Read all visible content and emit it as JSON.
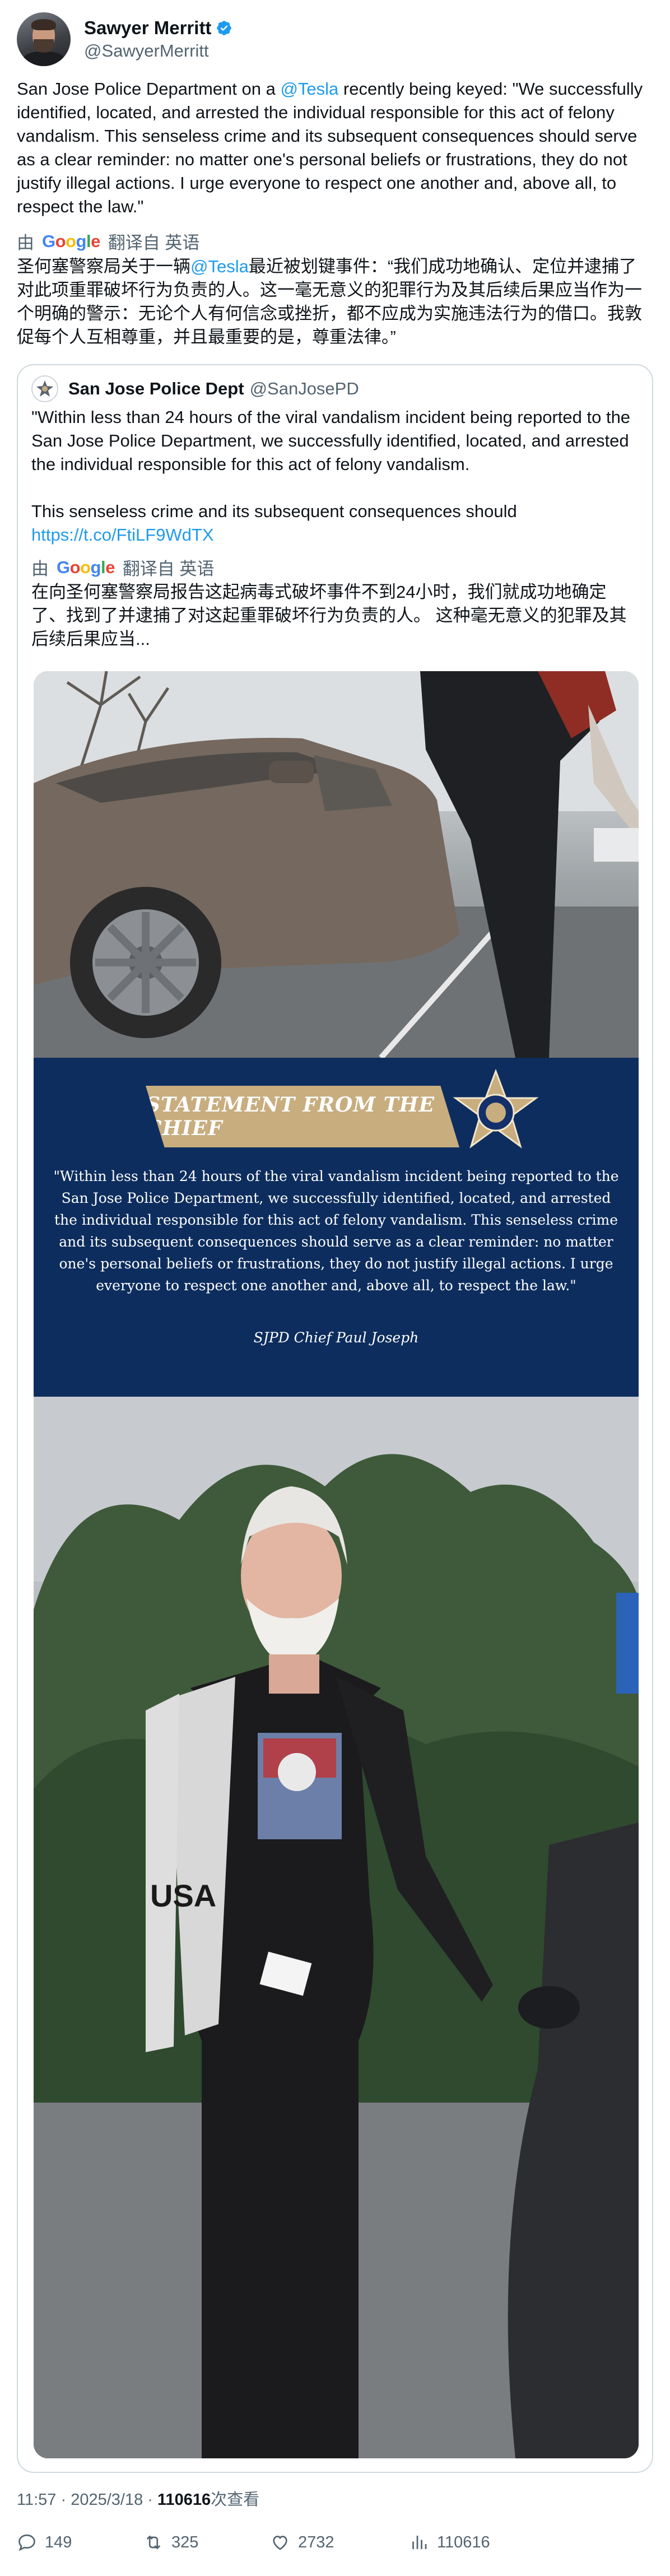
{
  "author": {
    "name": "Sawyer Merritt",
    "handle": "@SawyerMerritt"
  },
  "tweet": {
    "text_before_mention": "San Jose Police Department on a ",
    "mention": "@Tesla",
    "text_after_mention": " recently being keyed: \"We successfully identified, located, and arrested the individual responsible for this act of felony vandalism. This senseless crime and its subsequent consequences should serve as a clear reminder: no matter one's personal beliefs or frustrations, they do not justify illegal actions. I urge everyone to respect one another and, above all, to respect the law.\""
  },
  "translation": {
    "by_label": "由",
    "google_letters": [
      "G",
      "o",
      "o",
      "g",
      "l",
      "e"
    ],
    "from_label": "翻译自 英语",
    "text_before_mention": "圣何塞警察局关于一辆",
    "mention": "@Tesla",
    "text_after_mention": "最近被划键事件：“我们成功地确认、定位并逮捕了对此项重罪破坏行为负责的人。这一毫无意义的犯罪行为及其后续后果应当作为一个明确的警示：无论个人有何信念或挫折，都不应成为实施违法行为的借口。我敦促每个人互相尊重，并且最重要的是，尊重法律。”"
  },
  "quoted": {
    "name": "San Jose Police Dept",
    "handle": "@SanJosePD",
    "text": "\"Within less than 24 hours of the viral vandalism incident being reported to the San Jose Police Department, we successfully identified, located, and arrested the individual responsible for this act of felony vandalism.\n\nThis senseless crime and its subsequent consequences should ",
    "link": "https://t.co/FtiLF9WdTX",
    "translation_by": "由",
    "translation_from": "翻译自 英语",
    "translation_text": "在向圣何塞警察局报告这起病毒式破坏事件不到24小时，我们就成功地确定了、找到了并逮捕了对这起重罪破坏行为负责的人。 这种毫无意义的犯罪及其后续后果应当..."
  },
  "media": {
    "banner_title": "STATEMENT FROM THE CHIEF",
    "quote": "\"Within less than 24 hours of the viral vandalism incident being reported to the San Jose Police Department, we successfully identified, located, and arrested the individual responsible for this act of felony vandalism. This senseless crime and its subsequent consequences should serve as a clear reminder: no matter one's personal beliefs or frustrations, they do not justify illegal actions. I urge everyone to respect one another and, above all, to respect the law.\"",
    "signature": "SJPD  Chief Paul Joseph",
    "shirt_text": "USA"
  },
  "meta": {
    "time": "11:57 · 2025/3/18 · ",
    "views_count": "110616",
    "views_label": "次查看"
  },
  "actions": {
    "replies": "149",
    "reposts": "325",
    "likes": "2732",
    "views": "110616"
  },
  "colors": {
    "link": "#1d9bf0",
    "statement_bg": "#0d2d5e",
    "banner": "#c8ad7f"
  }
}
